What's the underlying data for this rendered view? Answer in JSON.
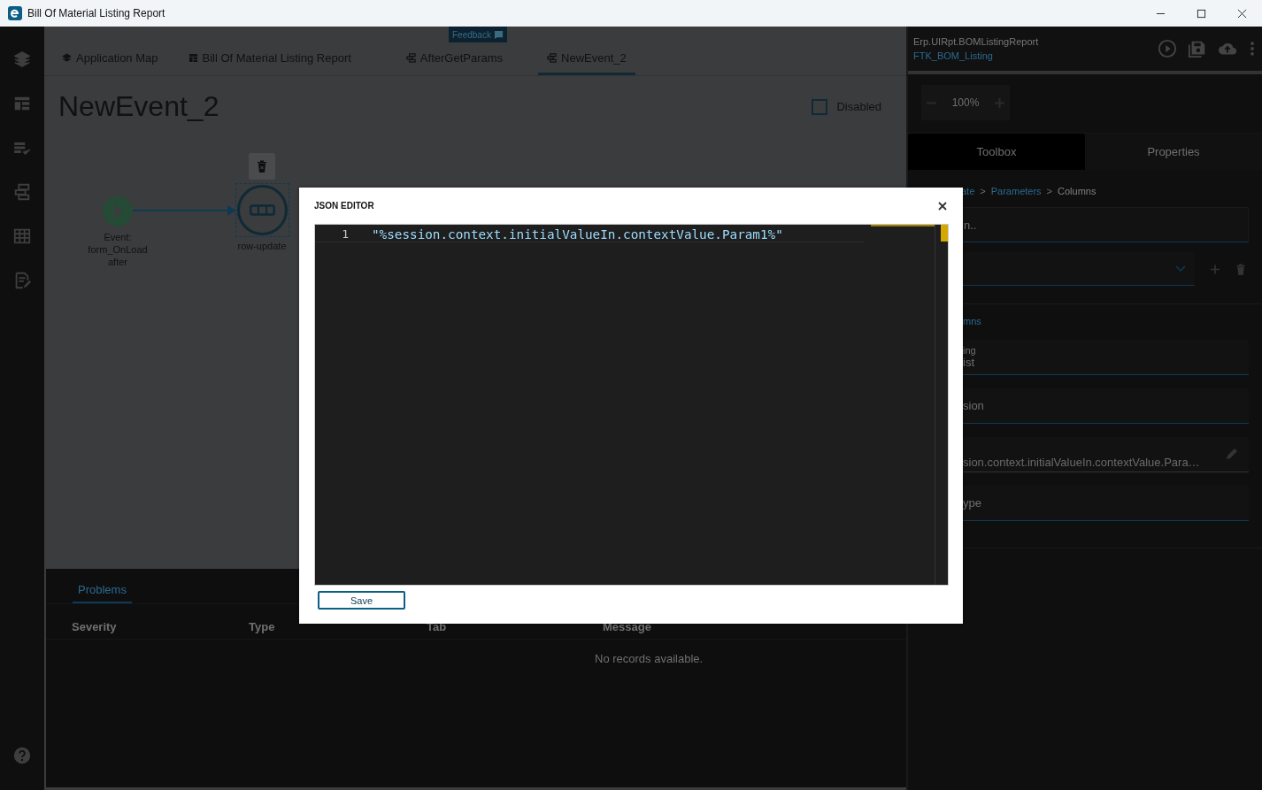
{
  "window": {
    "title": "Bill Of Material Listing Report"
  },
  "feedback": "Feedback",
  "tabs": [
    {
      "label": "Application Map",
      "kind": "map",
      "selected": false
    },
    {
      "label": "Bill Of Material Listing Report",
      "kind": "layout",
      "selected": false
    },
    {
      "label": "AfterGetParams",
      "kind": "event",
      "selected": false
    },
    {
      "label": "NewEvent_2",
      "kind": "event",
      "selected": true
    }
  ],
  "page_title": "NewEvent_2",
  "disabled_checkbox": {
    "label": "Disabled",
    "checked": false
  },
  "diagram": {
    "nodes": [
      {
        "kind": "start",
        "label": "Event: form_OnLoad after"
      },
      {
        "kind": "action",
        "label": "row-update",
        "selected": true
      }
    ]
  },
  "problems": {
    "tabs": [
      {
        "label": "Problems",
        "selected": true
      }
    ],
    "columns": [
      "Severity",
      "Type",
      "Tab",
      "Message"
    ],
    "empty_text": "No records available."
  },
  "right_panel": {
    "path": "Erp.UIRpt.BOMListingReport",
    "name": "FTK_BOM_Listing",
    "zoom": "100%",
    "tabs": [
      {
        "label": "Toolbox",
        "selected": true
      },
      {
        "label": "Properties",
        "selected": false
      }
    ],
    "breadcrumb": [
      "ate",
      "Parameters",
      "Columns"
    ],
    "breadcrumb_separator": ">",
    "search_value": "n..",
    "section": "mns",
    "fields": [
      {
        "kind": "text",
        "label": "ing",
        "value": "ist"
      },
      {
        "kind": "text",
        "value": "sion"
      },
      {
        "kind": "editable",
        "value": "sion.context.initialValueIn.contextValue.Para…"
      },
      {
        "kind": "text",
        "value": "ype"
      }
    ]
  },
  "json_editor": {
    "title": "JSON EDITOR",
    "lines": [
      {
        "number": "1",
        "text": "\"%session.context.initialValueIn.contextValue.Param1%\""
      }
    ],
    "save": "Save"
  }
}
